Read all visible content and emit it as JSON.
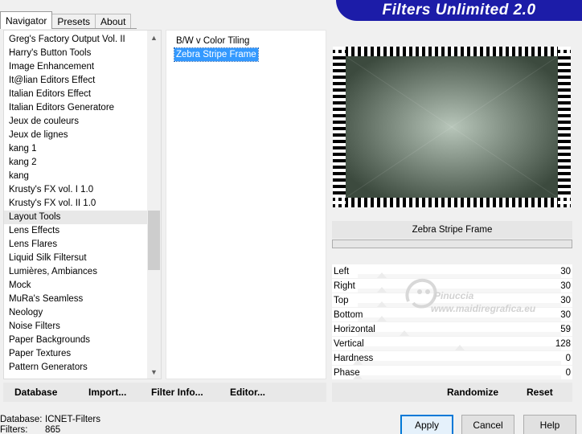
{
  "tabs": [
    {
      "label": "Navigator",
      "active": true
    },
    {
      "label": "Presets",
      "active": false
    },
    {
      "label": "About",
      "active": false
    }
  ],
  "banner": {
    "title": "Filters Unlimited 2.0",
    "color": "#1c1ca8"
  },
  "categories": {
    "items": [
      "Greg's Factory Output Vol. II",
      "Harry's Button Tools",
      "Image Enhancement",
      "It@lian Editors Effect",
      "Italian Editors Effect",
      "Italian Editors Generatore",
      "Jeux de couleurs",
      "Jeux de lignes",
      "kang 1",
      "kang 2",
      "kang",
      "Krusty's FX vol. I 1.0",
      "Krusty's FX vol. II 1.0",
      "Layout Tools",
      "Lens Effects",
      "Lens Flares",
      "Liquid Silk Filtersut",
      "Lumières, Ambiances",
      "Mock",
      "MuRa's Seamless",
      "Neology",
      "Noise Filters",
      "Paper Backgrounds",
      "Paper Textures",
      "Pattern Generators"
    ],
    "selected": "Layout Tools"
  },
  "filters": {
    "items": [
      "B/W v Color Tiling",
      "Zebra Stripe Frame"
    ],
    "selected": "Zebra Stripe Frame"
  },
  "preview": {
    "frame_color": "#000000",
    "center_color": "#b8c6ba",
    "edge_color": "#3c4a3e"
  },
  "filter_name": "Zebra Stripe Frame",
  "params": [
    {
      "name": "Left",
      "value": "30",
      "level": 0.12
    },
    {
      "name": "Right",
      "value": "30",
      "level": 0.12
    },
    {
      "name": "Top",
      "value": "30",
      "level": 0.12
    },
    {
      "name": "Bottom",
      "value": "30",
      "level": 0.12
    },
    {
      "name": "Horizontal",
      "value": "59",
      "level": 0.23
    },
    {
      "name": "Vertical",
      "value": "128",
      "level": 0.5
    },
    {
      "name": "Hardness",
      "value": "0",
      "level": 0
    },
    {
      "name": "Phase",
      "value": "0",
      "level": 0
    }
  ],
  "watermark": {
    "line1": "Pinuccia",
    "line2": "www.maidiregrafica.eu"
  },
  "toolbar_left": {
    "database": "Database",
    "import": "Import...",
    "filter_info": "Filter Info...",
    "editor": "Editor..."
  },
  "toolbar_right": {
    "randomize": "Randomize",
    "reset": "Reset"
  },
  "status": {
    "database_label": "Database:",
    "database_value": "ICNET-Filters",
    "filters_label": "Filters:",
    "filters_value": "865"
  },
  "dialog_buttons": {
    "apply": "Apply",
    "cancel": "Cancel",
    "help": "Help"
  },
  "accent_color": "#3399ff"
}
